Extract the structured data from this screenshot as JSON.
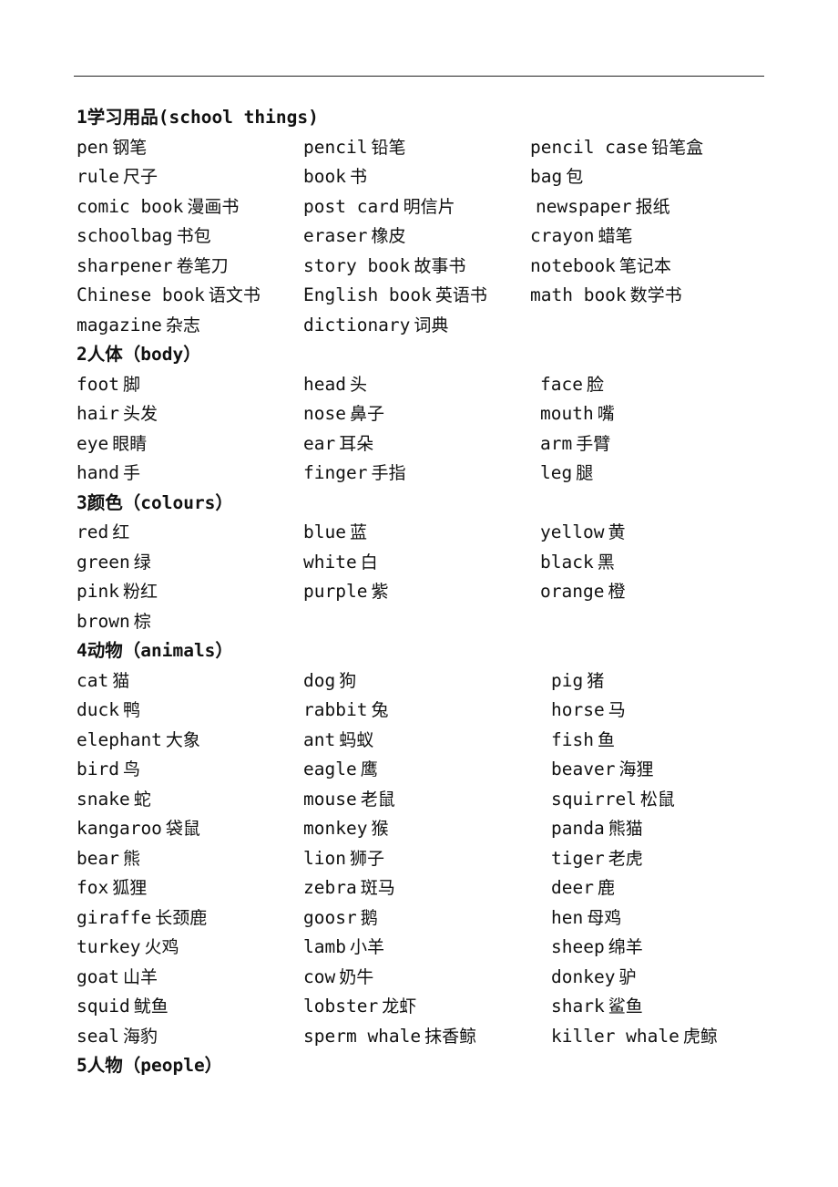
{
  "sections": [
    {
      "heading": "1学习用品(school things)",
      "rows": [
        [
          [
            "pen",
            "钢笔"
          ],
          [
            "pencil",
            "铅笔"
          ],
          [
            "pencil case",
            "铅笔盒"
          ]
        ],
        [
          [
            "rule",
            "尺子"
          ],
          [
            "book",
            "书"
          ],
          [
            "bag",
            "包"
          ]
        ],
        [
          [
            "comic book",
            "漫画书"
          ],
          [
            "post card",
            "明信片"
          ],
          [
            "newspaper",
            "报纸"
          ]
        ],
        [
          [
            "schoolbag",
            "书包"
          ],
          [
            "eraser",
            "橡皮"
          ],
          [
            "crayon",
            "蜡笔"
          ]
        ],
        [
          [
            "sharpener",
            "卷笔刀"
          ],
          [
            "story book",
            "故事书"
          ],
          [
            "notebook",
            "笔记本"
          ]
        ],
        [
          [
            "Chinese book",
            "语文书"
          ],
          [
            "English book",
            "英语书"
          ],
          [
            "math book",
            "数学书"
          ]
        ],
        [
          [
            "magazine",
            "杂志"
          ],
          [
            "dictionary",
            "词典"
          ],
          null
        ]
      ]
    },
    {
      "heading": "2人体（body）",
      "rows": [
        [
          [
            "foot",
            "脚"
          ],
          [
            "head",
            "头"
          ],
          [
            "face",
            "脸"
          ]
        ],
        [
          [
            "hair",
            "头发"
          ],
          [
            "nose",
            "鼻子"
          ],
          [
            "mouth",
            "嘴"
          ]
        ],
        [
          [
            "eye",
            "眼睛"
          ],
          [
            "ear",
            "耳朵"
          ],
          [
            "arm",
            "手臂"
          ]
        ],
        [
          [
            "hand",
            "手"
          ],
          [
            "finger",
            "手指"
          ],
          [
            "leg",
            "腿"
          ]
        ]
      ]
    },
    {
      "heading": "3颜色（colours）",
      "rows": [
        [
          [
            "red",
            "红"
          ],
          [
            "blue",
            "蓝"
          ],
          [
            "yellow",
            "黄"
          ]
        ],
        [
          [
            "green",
            "绿"
          ],
          [
            "white",
            "白"
          ],
          [
            "black",
            "黑"
          ]
        ],
        [
          [
            "pink",
            "粉红"
          ],
          [
            "purple",
            "紫"
          ],
          [
            "orange",
            "橙"
          ]
        ],
        [
          [
            "brown",
            "棕"
          ],
          null,
          null
        ]
      ]
    },
    {
      "heading": "4动物（animals）",
      "rows": [
        [
          [
            "cat",
            "猫"
          ],
          [
            "dog",
            "狗"
          ],
          [
            "pig",
            "猪"
          ]
        ],
        [
          [
            "duck",
            "鸭"
          ],
          [
            "rabbit",
            "兔"
          ],
          [
            "horse",
            "马"
          ]
        ],
        [
          [
            "elephant",
            "大象"
          ],
          [
            "ant",
            "蚂蚁"
          ],
          [
            "fish",
            "鱼"
          ]
        ],
        [
          [
            "bird",
            "鸟"
          ],
          [
            "eagle",
            "鹰"
          ],
          [
            "beaver",
            "海狸"
          ]
        ],
        [
          [
            "snake",
            "蛇"
          ],
          [
            "mouse",
            "老鼠"
          ],
          [
            "squirrel",
            "松鼠"
          ]
        ],
        [
          [
            "kangaroo",
            "袋鼠"
          ],
          [
            "monkey",
            "猴"
          ],
          [
            "panda",
            "熊猫"
          ]
        ],
        [
          [
            "bear",
            "熊"
          ],
          [
            "lion",
            "狮子"
          ],
          [
            "tiger",
            "老虎"
          ]
        ],
        [
          [
            "fox",
            "狐狸"
          ],
          [
            "zebra",
            "斑马"
          ],
          [
            "deer",
            "鹿"
          ]
        ],
        [
          [
            "giraffe",
            "长颈鹿"
          ],
          [
            "goosr",
            "鹅"
          ],
          [
            "hen",
            "母鸡"
          ]
        ],
        [
          [
            "turkey",
            "火鸡"
          ],
          [
            "lamb",
            "小羊"
          ],
          [
            "sheep",
            "绵羊"
          ]
        ],
        [
          [
            "goat",
            "山羊"
          ],
          [
            "cow",
            "奶牛"
          ],
          [
            "donkey",
            "驴"
          ]
        ],
        [
          [
            "squid",
            "鱿鱼"
          ],
          [
            "lobster",
            "龙虾"
          ],
          [
            "shark",
            "鲨鱼"
          ]
        ],
        [
          [
            "seal",
            "海豹"
          ],
          [
            "sperm whale",
            "抹香鲸"
          ],
          [
            "killer whale",
            "虎鲸"
          ]
        ]
      ]
    },
    {
      "heading": "5人物（people）",
      "rows": []
    }
  ]
}
